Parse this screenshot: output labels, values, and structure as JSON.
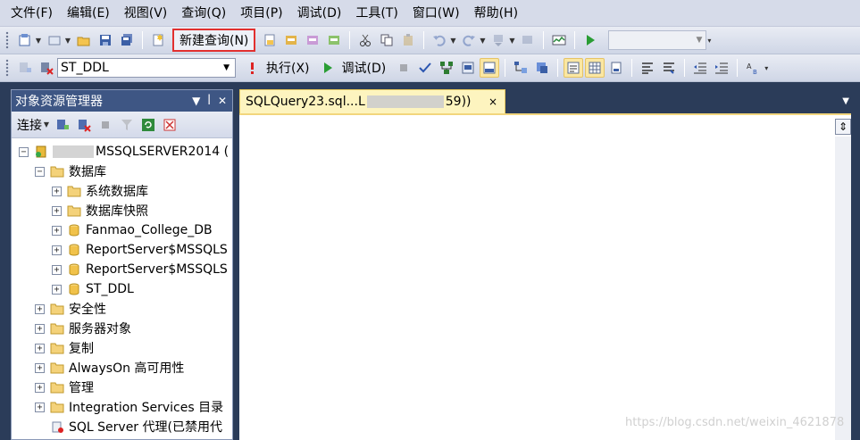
{
  "menu": [
    "文件(F)",
    "编辑(E)",
    "视图(V)",
    "查询(Q)",
    "项目(P)",
    "调试(D)",
    "工具(T)",
    "窗口(W)",
    "帮助(H)"
  ],
  "toolbar": {
    "new_query_label": "新建查询(N)",
    "database_selected": "ST_DDL",
    "execute_label": "执行(X)",
    "debug_label": "调试(D)"
  },
  "object_explorer": {
    "title": "对象资源管理器",
    "connect_label": "连接",
    "server_suffix": "MSSQLSERVER2014 (",
    "nodes": {
      "databases": "数据库",
      "system_db": "系统数据库",
      "snapshots": "数据库快照",
      "db1": "Fanmao_College_DB",
      "db2": "ReportServer$MSSQLS",
      "db3": "ReportServer$MSSQLS",
      "db4": "ST_DDL",
      "security": "安全性",
      "server_objects": "服务器对象",
      "replication": "复制",
      "alwayson": "AlwaysOn 高可用性",
      "management": "管理",
      "integration": "Integration Services 目录",
      "agent": "SQL Server 代理(已禁用代"
    }
  },
  "editor": {
    "tab_prefix": "SQLQuery23.sql...L",
    "tab_suffix": "59))",
    "tab_close": "×"
  },
  "watermark": "https://blog.csdn.net/weixin_4621878",
  "colors": {
    "highlight_box": "#e2302f",
    "title_bar": "#3e5684",
    "tab_active": "#fdf4bf"
  }
}
